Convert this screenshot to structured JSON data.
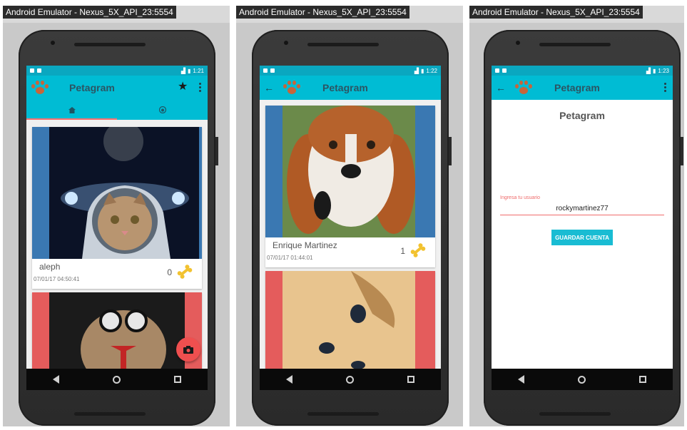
{
  "windows": [
    {
      "title": "Android Emulator - Nexus_5X_API_23:5554",
      "time": "1:21"
    },
    {
      "title": "Android Emulator - Nexus_5X_API_23:5554",
      "time": "1:22"
    },
    {
      "title": "Android Emulator - Nexus_5X_API_23:5554",
      "time": "1:23"
    }
  ],
  "app": {
    "name": "Petagram"
  },
  "screen1": {
    "posts": [
      {
        "name": "aleph",
        "date": "07/01/17 04:50:41",
        "likes": "0"
      }
    ]
  },
  "screen2": {
    "posts": [
      {
        "name": "Enrique Martinez",
        "date": "07/01/17 01:44:01",
        "likes": "1"
      }
    ]
  },
  "screen3": {
    "title": "Petagram",
    "field_label": "Ingresa tu usuario",
    "field_value": "rockymartinez77",
    "button_label": "GUARDAR CUENTA"
  },
  "colors": {
    "primary": "#00bcd4",
    "status": "#0aa7c0",
    "accent": "#ef4f4f",
    "bone": "#f2c230"
  },
  "icons": [
    "paw-icon",
    "star-badge-icon",
    "more-vert-icon",
    "home-icon",
    "dog-face-icon",
    "back-arrow-icon",
    "bone-icon",
    "camera-icon",
    "nav-back-icon",
    "nav-home-icon",
    "nav-recent-icon"
  ]
}
